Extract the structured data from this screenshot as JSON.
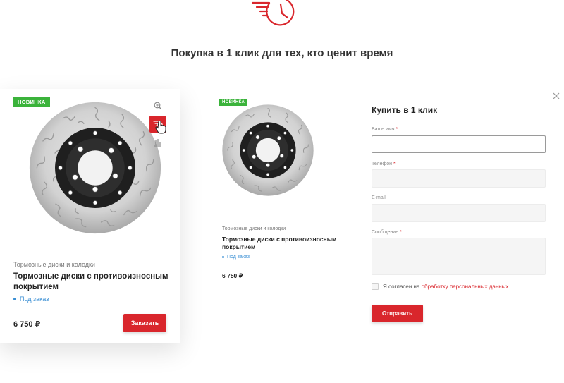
{
  "headline": "Покупка в 1 клик для тех, кто ценит время",
  "colors": {
    "accent": "#d9262c",
    "badge": "#3bb33b",
    "availability": "#3a8fd4"
  },
  "card": {
    "badge": "Новинка",
    "category": "Тормозные диски и колодки",
    "title": "Тормозные диски с противоизносным покрытием",
    "availability": "Под заказ",
    "price": "6 750 ₽",
    "order_label": "Заказать",
    "tools": [
      "zoom-icon",
      "quick-buy-icon",
      "compare-icon"
    ]
  },
  "product": {
    "badge": "Новинка",
    "category": "Тормозные диски и колодки",
    "title": "Тормозные диски с противоизносным покрытием",
    "availability": "Под заказ",
    "price": "6 750 ₽"
  },
  "form": {
    "title": "Купить в 1 клик",
    "fields": {
      "name": {
        "label": "Ваше имя",
        "required": "*",
        "value": ""
      },
      "phone": {
        "label": "Телефон",
        "required": "*",
        "value": ""
      },
      "email": {
        "label": "E-mail",
        "value": ""
      },
      "message": {
        "label": "Сообщение",
        "required": "*",
        "value": ""
      }
    },
    "consent_text": "Я согласен на ",
    "consent_link": "обработку персональных данных",
    "submit_label": "Отправить"
  }
}
